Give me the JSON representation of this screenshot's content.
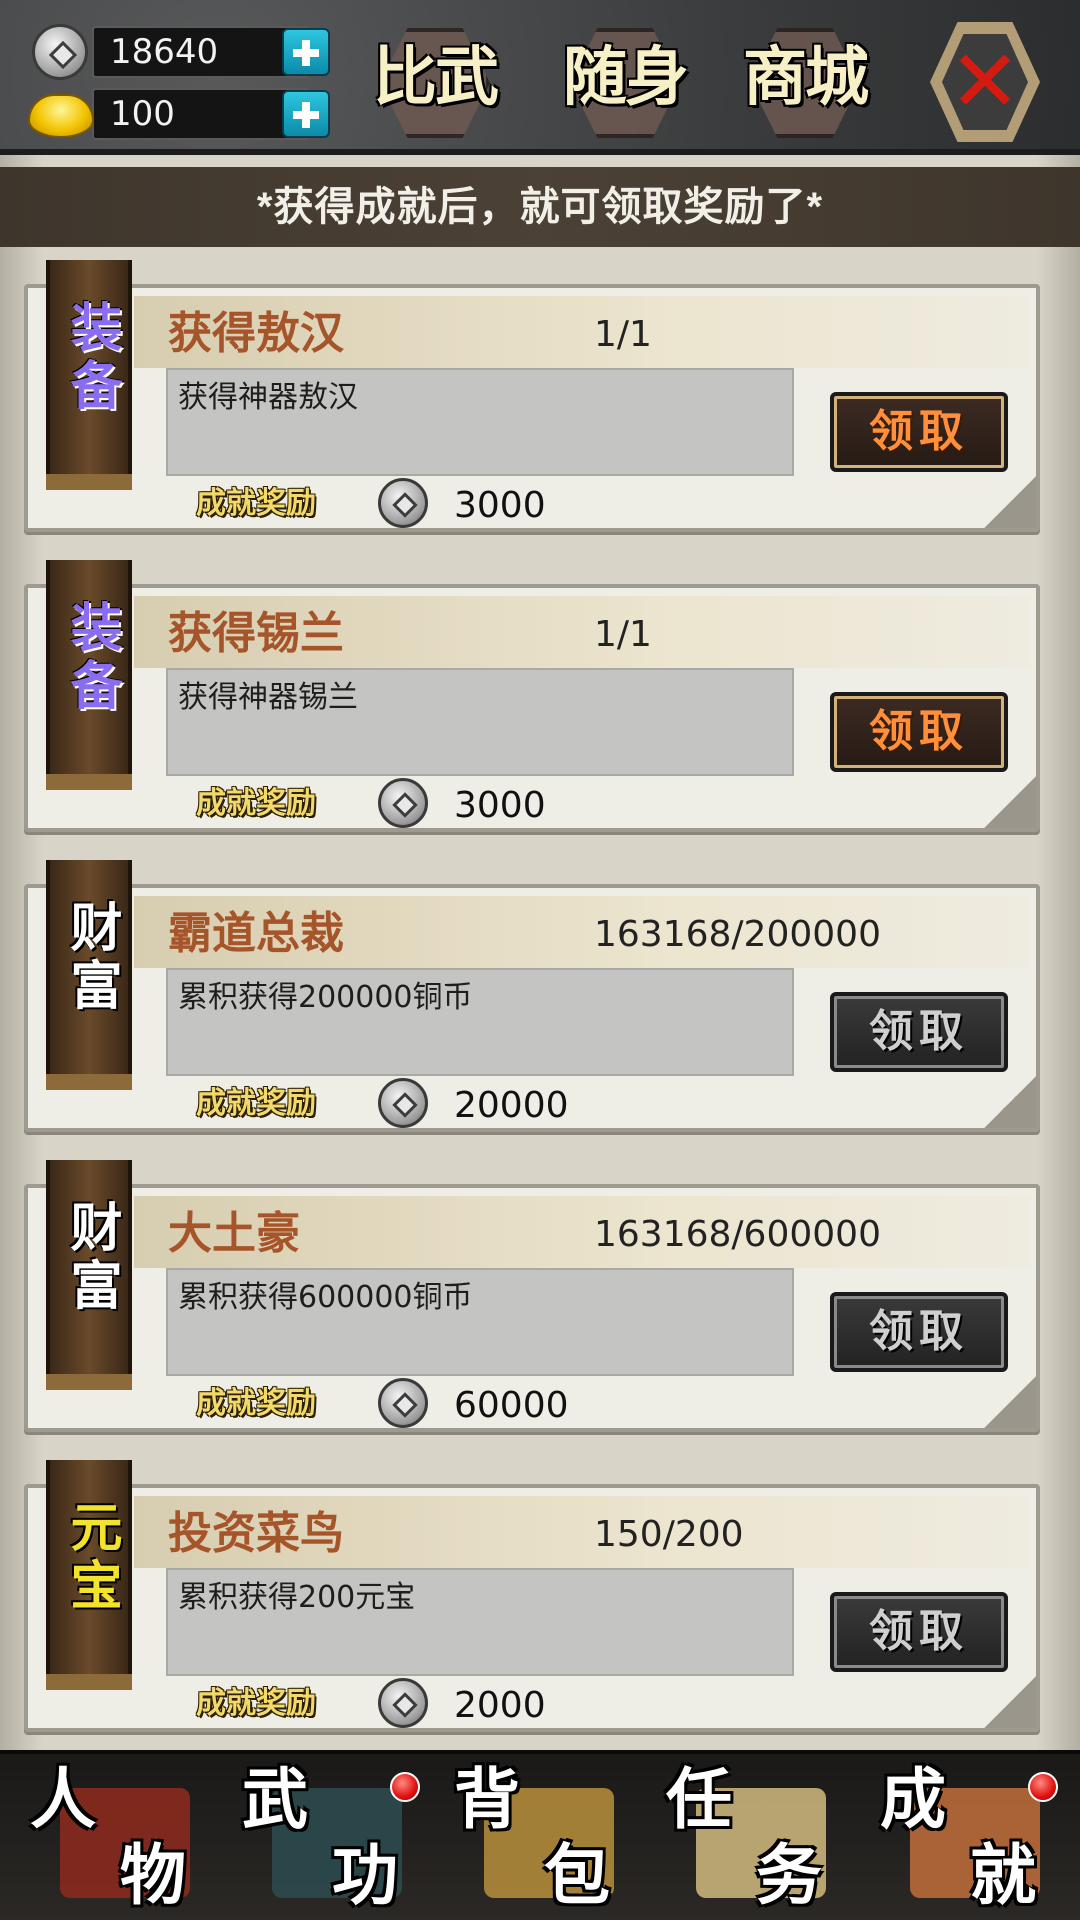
{
  "currency": {
    "copper": "18640",
    "ingot": "100"
  },
  "top_tabs": {
    "duel": "比武",
    "carry": "随身",
    "shop": "商城",
    "close": "✕"
  },
  "banner_text": "*获得成就后，就可领取奖励了*",
  "achievements": [
    {
      "category": "装备",
      "category_color": "#8a6cf0",
      "title": "获得敖汉",
      "progress": "1/1",
      "description": "获得神器敖汉",
      "reward_label": "成就奖励",
      "reward": "3000",
      "claim_label": "领取",
      "claimable": true
    },
    {
      "category": "装备",
      "category_color": "#8a6cf0",
      "title": "获得锡兰",
      "progress": "1/1",
      "description": "获得神器锡兰",
      "reward_label": "成就奖励",
      "reward": "3000",
      "claim_label": "领取",
      "claimable": true
    },
    {
      "category": "财富",
      "category_color": "#ffffff",
      "title": "霸道总裁",
      "progress": "163168/200000",
      "description": "累积获得200000铜币",
      "reward_label": "成就奖励",
      "reward": "20000",
      "claim_label": "领取",
      "claimable": false
    },
    {
      "category": "财富",
      "category_color": "#ffffff",
      "title": "大土豪",
      "progress": "163168/600000",
      "description": "累积获得600000铜币",
      "reward_label": "成就奖励",
      "reward": "60000",
      "claim_label": "领取",
      "claimable": false
    },
    {
      "category": "元宝",
      "category_color": "#f3e32a",
      "title": "投资菜鸟",
      "progress": "150/200",
      "description": "累积获得200元宝",
      "reward_label": "成就奖励",
      "reward": "2000",
      "claim_label": "领取",
      "claimable": false
    }
  ],
  "bottom_nav": [
    {
      "c1": "人",
      "c2": "物",
      "notification": false,
      "art_color": "#8a2a1e"
    },
    {
      "c1": "武",
      "c2": "功",
      "notification": true,
      "art_color": "#2c4a4e"
    },
    {
      "c1": "背",
      "c2": "包",
      "notification": false,
      "art_color": "#b08a3a"
    },
    {
      "c1": "任",
      "c2": "务",
      "notification": false,
      "art_color": "#c8b27a"
    },
    {
      "c1": "成",
      "c2": "就",
      "notification": true,
      "art_color": "#b86a3a"
    }
  ]
}
